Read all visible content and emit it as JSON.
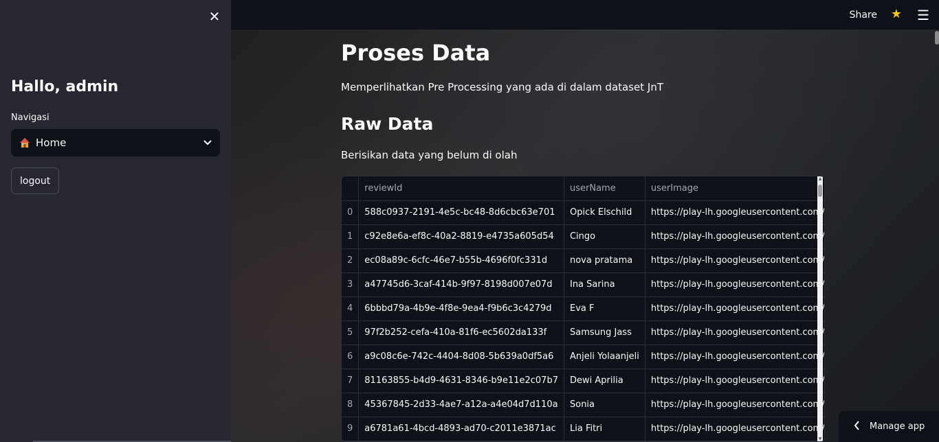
{
  "sidebar": {
    "close_glyph": "✕",
    "greeting": "Hallo, admin",
    "nav_label": "Navigasi",
    "nav_selected": "Home",
    "nav_icon": "house-icon",
    "logout_label": "logout"
  },
  "header": {
    "share_label": "Share",
    "star_icon": "star-icon",
    "menu_icon": "hamburger-menu-icon"
  },
  "main": {
    "title": "Proses Data",
    "intro": "Memperlihatkan Pre Processing yang ada di dalam dataset JnT",
    "raw_title": "Raw Data",
    "raw_desc": "Berisikan data yang belum di olah"
  },
  "table": {
    "columns": [
      "",
      "reviewId",
      "userName",
      "userImage"
    ],
    "rows": [
      [
        "0",
        "588c0937-2191-4e5c-bc48-8d6cbc63e701",
        "Opick Elschild",
        "https://play-lh.googleusercontent.com/a-/AD_"
      ],
      [
        "1",
        "c92e8e6a-ef8c-40a2-8819-e4735a605d54",
        "Cingo",
        "https://play-lh.googleusercontent.com/a-/AD_"
      ],
      [
        "2",
        "ec08a89c-6cfc-46e7-b55b-4696f0fc331d",
        "nova pratama",
        "https://play-lh.googleusercontent.com/a-/AD_"
      ],
      [
        "3",
        "a47745d6-3caf-414b-9f97-8198d007e07d",
        "Ina Sarina",
        "https://play-lh.googleusercontent.com/a/AAc"
      ],
      [
        "4",
        "6bbbd79a-4b9e-4f8e-9ea4-f9b6c3c4279d",
        "Eva F",
        "https://play-lh.googleusercontent.com/a-/AD_"
      ],
      [
        "5",
        "97f2b252-cefa-410a-81f6-ec5602da133f",
        "Samsung Jass",
        "https://play-lh.googleusercontent.com/a/AAc"
      ],
      [
        "6",
        "a9c08c6e-742c-4404-8d08-5b639a0df5a6",
        "Anjeli Yolaanjeli",
        "https://play-lh.googleusercontent.com/a-/AD_"
      ],
      [
        "7",
        "81163855-b4d9-4631-8346-b9e11e2c07b7",
        "Dewi Aprilia",
        "https://play-lh.googleusercontent.com/a-/AD_"
      ],
      [
        "8",
        "45367845-2d33-4ae7-a12a-a4e04d7d110a",
        "Sonia",
        "https://play-lh.googleusercontent.com/a/AAc"
      ],
      [
        "9",
        "a6781a61-4bcd-4893-ad70-c2011e3871ac",
        "Lia Fitri",
        "https://play-lh.googleusercontent.com/a-/AD_"
      ]
    ]
  },
  "manage_app": {
    "label": "Manage app",
    "icon": "chevron-left-icon"
  },
  "colors": {
    "background": "#0e1117",
    "sidebar": "#262730",
    "star": "#f5c518",
    "text": "#fafafa"
  }
}
